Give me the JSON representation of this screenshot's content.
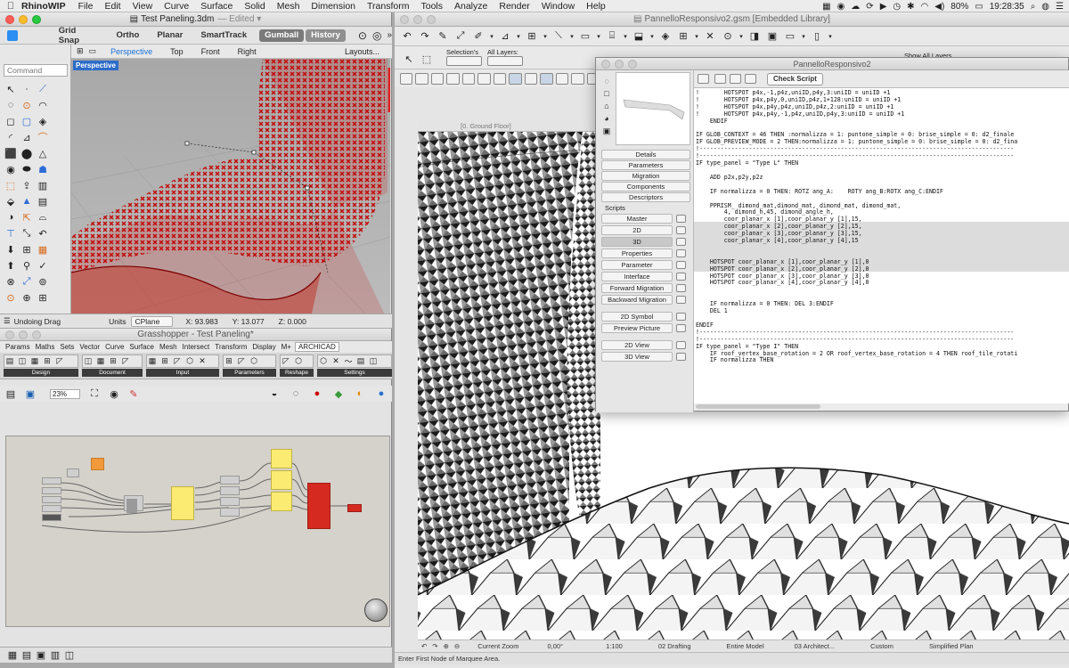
{
  "menubar": {
    "app": "RhinoWIP",
    "items": [
      "File",
      "Edit",
      "View",
      "Curve",
      "Surface",
      "Solid",
      "Mesh",
      "Dimension",
      "Transform",
      "Tools",
      "Analyze",
      "Render",
      "Window",
      "Help"
    ],
    "battery": "80%",
    "clock": "19:28:35"
  },
  "rhino": {
    "title": "Test Paneling.3dm",
    "edited": "— Edited ▾",
    "toolbar": [
      "Grid Snap",
      "Ortho",
      "Planar",
      "SmartTrack",
      "Gumball",
      "History"
    ],
    "tabs": [
      "Perspective",
      "Top",
      "Front",
      "Right"
    ],
    "layouts": "Layouts...",
    "command_placeholder": "Command",
    "viewport_label": "Perspective",
    "status": {
      "message": "Undoing Drag",
      "units_label": "Units",
      "cplane": "CPlane",
      "x": "X: 93.983",
      "y": "Y: 13.077",
      "z": "Z: 0.000"
    }
  },
  "gh": {
    "title": "Grasshopper - Test Paneling*",
    "menu": [
      "Params",
      "Maths",
      "Sets",
      "Vector",
      "Curve",
      "Surface",
      "Mesh",
      "Intersect",
      "Transform",
      "Display",
      "M+",
      "ARCHICAD"
    ],
    "groups": [
      "Design",
      "Document",
      "Input",
      "Parameters",
      "Reshape",
      "Settings"
    ],
    "zoom": "23%"
  },
  "archicad": {
    "title": "PannelloResponsivo2.gsm [Embedded Library]",
    "selections_label": "Selection's",
    "all_layers": "All Layers:",
    "show_all": "Show All Layers",
    "floor_tab": "[0. Ground Floor]",
    "status_hint": "Enter First Node of Marquee Area.",
    "bottom": {
      "zoom": "Current Zoom",
      "angle": "0,00°",
      "scale": "1:100",
      "view": "02 Drafting",
      "model": "Entire Model",
      "arch": "03 Architect...",
      "custom": "Custom",
      "plan": "Simplified Plan"
    }
  },
  "editor": {
    "title": "PannelloResponsivo2",
    "check_script": "Check Script",
    "sections": [
      "Details",
      "Parameters",
      "Migration",
      "Components",
      "Descriptors"
    ],
    "scripts_label": "Scripts",
    "scripts": [
      "Master",
      "2D",
      "3D",
      "Properties",
      "Parameter",
      "Interface",
      "Forward Migration",
      "Backward Migration"
    ],
    "extra": [
      "2D Symbol",
      "Preview Picture"
    ],
    "views": [
      "2D View",
      "3D View"
    ],
    "code": [
      "!       HOTSPOT p4x,-1,p4z,uniID,p4y,3:uniID = uniID +1",
      "!       HOTSPOT p4x,p4y,0,uniID,p4z,1+128:uniID = uniID +1",
      "!       HOTSPOT p4x,p4y,p4z,uniID,p4z,2:uniID = uniID +1",
      "!       HOTSPOT p4x,p4y,-1,p4z,uniID,p4y,3:uniID = uniID +1",
      "    ENDIF",
      "",
      "IF GLOB_CONTEXT = 46 THEN :normalizza = 1: puntone_simple = 0: brise_simple = 0: d2_finale",
      "IF GLOB_PREVIEW_MODE = 2 THEN:normalizza = 1: puntone_simple = 0: brise_simple = 0: d2_fina",
      "!-----------------------------------------------------------------------------------------",
      "!-----------------------------------------------------------------------------------------",
      "IF type_panel = \"Type L\" THEN",
      "",
      "    ADD p2x,p2y,p2z",
      "",
      "    IF normalizza = 0 THEN: ROTZ ang_A:    ROTY ang_B:ROTX ang_C:ENDIF",
      "",
      "    PPRISM_ dimond_mat,dimond_mat, dimond_mat, dimond_mat,",
      "        4, dimond_h,45, dimond_angle_h,",
      "        coor_planar_x [1],coor_planar_y [1],15,",
      "        coor_planar_x [2],coor_planar_y [2],15,",
      "        coor_planar_x [3],coor_planar_y [3],15,",
      "        coor_planar_x [4],coor_planar_y [4],15",
      "",
      "",
      "    HOTSPOT coor_planar_x [1],coor_planar_y [1],0",
      "    HOTSPOT coor_planar_x [2],coor_planar_y [2],0",
      "    HOTSPOT coor_planar_x [3],coor_planar_y [3],0",
      "    HOTSPOT coor_planar_x [4],coor_planar_y [4],0",
      "",
      "",
      "    IF normalizza = 0 THEN: DEL 3:ENDIF",
      "    DEL 1",
      "",
      "ENDIF",
      "!-----------------------------------------------------------------------------------------",
      "!-----------------------------------------------------------------------------------------",
      "IF type_panel = \"Type I\" THEN",
      "    IF roof_vertex_base_rotation = 2 OR roof_vertex_base_rotation = 4 THEN roof_tile_rotati",
      "    IF normalizza THEN"
    ]
  }
}
